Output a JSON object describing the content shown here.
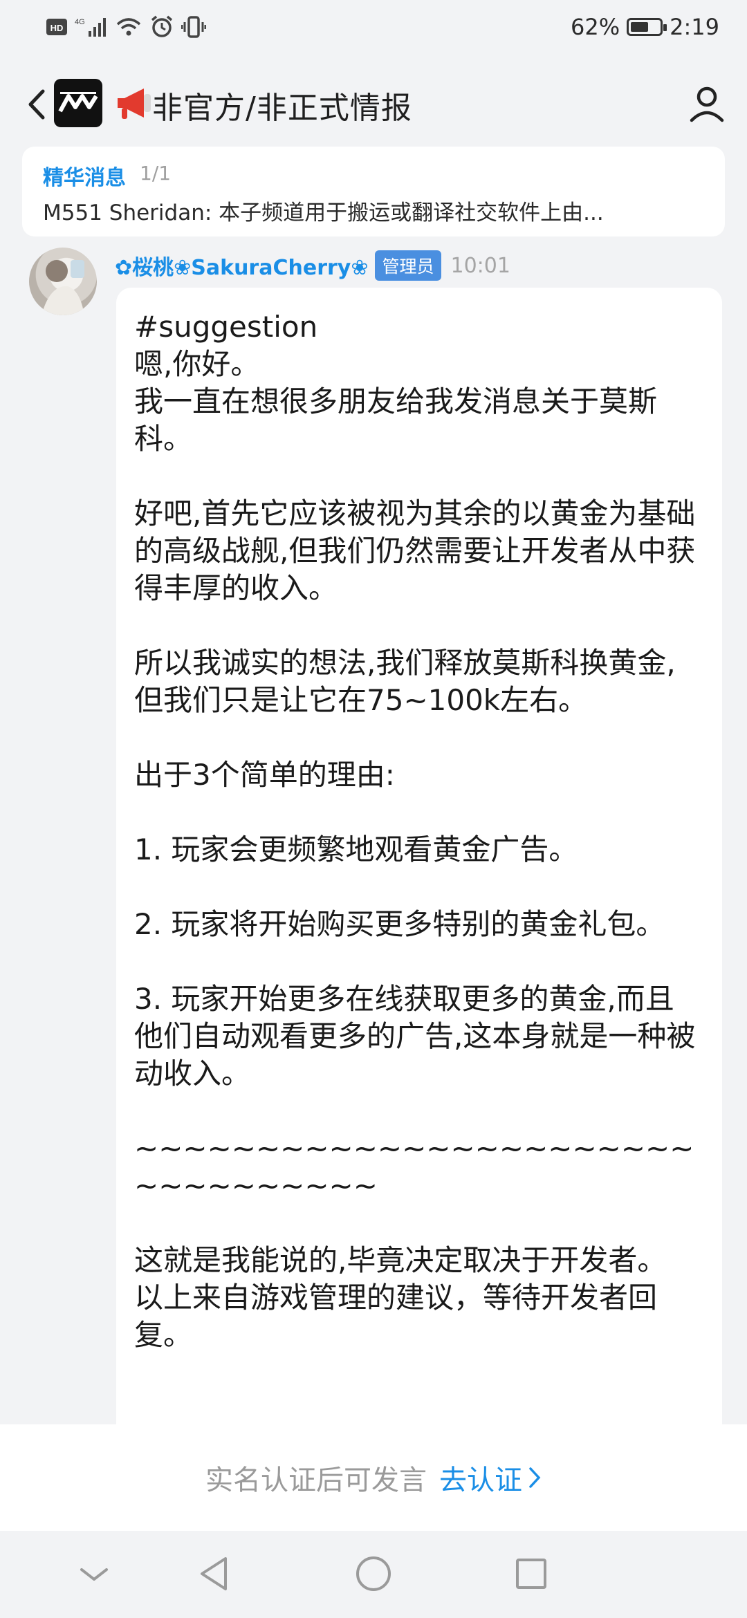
{
  "status_bar": {
    "left_indicators": [
      "HD",
      "4G",
      "signal",
      "wifi",
      "alarm",
      "vibrate"
    ],
    "battery_percent": "62%",
    "battery_level": 0.62,
    "time": "2:19"
  },
  "header": {
    "title": "非官方/非正式情报",
    "icons": [
      "back-icon",
      "app-logo",
      "megaphone-icon",
      "profile-icon"
    ]
  },
  "pinned": {
    "label": "精华消息",
    "count": "1/1",
    "preview": "M551 Sheridan: 本子频道用于搬运或翻译社交软件上由..."
  },
  "message": {
    "sender": "✿桜桃❀SakuraCherry❀",
    "role": "管理员",
    "time": "10:01",
    "text": "#suggestion\n嗯,你好。\n我一直在想很多朋友给我发消息关于莫斯科。\n\n好吧,首先它应该被视为其余的以黄金为基础的高级战舰,但我们仍然需要让开发者从中获得丰厚的收入。\n\n所以我诚实的想法,我们释放莫斯科换黄金,但我们只是让它在75~100k左右。\n\n出于3个简单的理由:\n\n1. 玩家会更频繁地观看黄金广告。\n\n2. 玩家将开始购买更多特别的黄金礼包。\n\n3. 玩家开始更多在线获取更多的黄金,而且他们自动观看更多的广告,这本身就是一种被动收入。\n\n~~~~~~~~~~~~~~~~~~~~~~~~~~~~~~~~~\n\n这就是我能说的,毕竟决定取决于开发者。\n以上来自游戏管理的建议，等待开发者回复。"
  },
  "composer": {
    "hint": "实名认证后可发言",
    "link": "去认证"
  },
  "navbar": {
    "buttons": [
      "collapse-icon",
      "back-triangle-icon",
      "home-circle-icon",
      "recents-square-icon"
    ]
  },
  "colors": {
    "accent": "#1a8ee6",
    "badge": "#4a8fe0",
    "background": "#f2f3f5"
  }
}
